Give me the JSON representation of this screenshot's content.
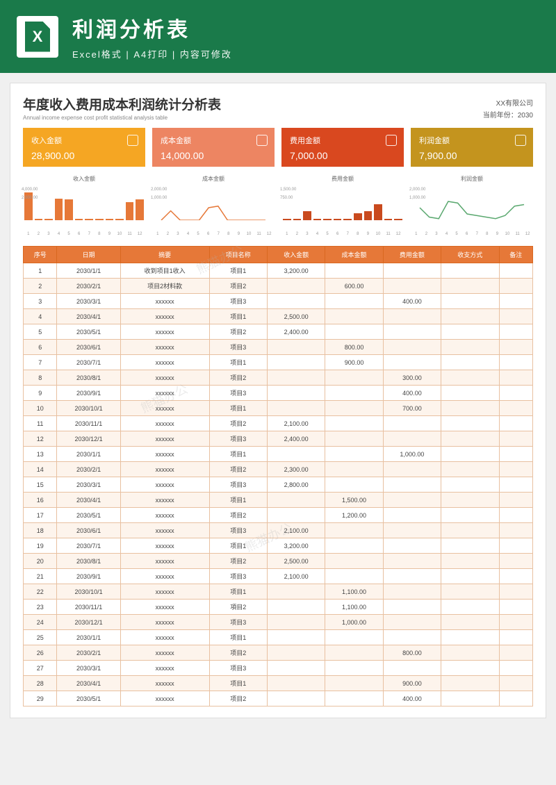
{
  "banner": {
    "title": "利润分析表",
    "sub": "Excel格式 | A4打印 | 内容可修改"
  },
  "sheet": {
    "title": "年度收入费用成本利润统计分析表",
    "sub": "Annual income expense cost profit statistical analysis table",
    "company": "XX有限公司",
    "year": "当前年份：2030"
  },
  "cards": [
    {
      "label": "收入金额",
      "value": "28,900.00"
    },
    {
      "label": "成本金额",
      "value": "14,000.00"
    },
    {
      "label": "费用金额",
      "value": "7,000.00"
    },
    {
      "label": "利润金额",
      "value": "7,900.00"
    }
  ],
  "chart_data": [
    {
      "type": "bar",
      "title": "收入金额",
      "categories": [
        "1",
        "2",
        "3",
        "4",
        "5",
        "6",
        "7",
        "8",
        "9",
        "10",
        "11",
        "12"
      ],
      "values": [
        3200,
        0,
        0,
        2500,
        2400,
        0,
        0,
        0,
        0,
        0,
        2100,
        2400
      ],
      "ylim": [
        0,
        4000
      ],
      "color": "#e67838"
    },
    {
      "type": "line",
      "title": "成本金额",
      "categories": [
        "1",
        "2",
        "3",
        "4",
        "5",
        "6",
        "7",
        "8",
        "9",
        "10",
        "11",
        "12"
      ],
      "values": [
        0,
        600,
        0,
        0,
        0,
        800,
        900,
        0,
        0,
        0,
        0,
        0
      ],
      "ylim": [
        0,
        2000
      ],
      "color": "#e67838"
    },
    {
      "type": "bar",
      "title": "费用金额",
      "categories": [
        "1",
        "2",
        "3",
        "4",
        "5",
        "6",
        "7",
        "8",
        "9",
        "10",
        "11",
        "12"
      ],
      "values": [
        0,
        0,
        400,
        0,
        0,
        0,
        0,
        300,
        400,
        700,
        0,
        0
      ],
      "ylim": [
        0,
        1500
      ],
      "color": "#c94a1e"
    },
    {
      "type": "line",
      "title": "利润金额",
      "categories": [
        "1",
        "2",
        "3",
        "4",
        "5",
        "6",
        "7",
        "8",
        "9",
        "10",
        "11",
        "12"
      ],
      "values": [
        800,
        200,
        100,
        1200,
        1100,
        400,
        300,
        200,
        100,
        300,
        900,
        1000
      ],
      "ylim": [
        0,
        2000
      ],
      "color": "#5aa86f"
    }
  ],
  "table": {
    "headers": [
      "序号",
      "日期",
      "摘要",
      "项目名称",
      "收入金额",
      "成本金额",
      "费用金额",
      "收支方式",
      "备注"
    ],
    "rows": [
      [
        "1",
        "2030/1/1",
        "收到项目1收入",
        "项目1",
        "3,200.00",
        "",
        "",
        "",
        ""
      ],
      [
        "2",
        "2030/2/1",
        "项目2材料款",
        "项目2",
        "",
        "600.00",
        "",
        "",
        ""
      ],
      [
        "3",
        "2030/3/1",
        "xxxxxx",
        "项目3",
        "",
        "",
        "400.00",
        "",
        ""
      ],
      [
        "4",
        "2030/4/1",
        "xxxxxx",
        "项目1",
        "2,500.00",
        "",
        "",
        "",
        ""
      ],
      [
        "5",
        "2030/5/1",
        "xxxxxx",
        "项目2",
        "2,400.00",
        "",
        "",
        "",
        ""
      ],
      [
        "6",
        "2030/6/1",
        "xxxxxx",
        "项目3",
        "",
        "800.00",
        "",
        "",
        ""
      ],
      [
        "7",
        "2030/7/1",
        "xxxxxx",
        "项目1",
        "",
        "900.00",
        "",
        "",
        ""
      ],
      [
        "8",
        "2030/8/1",
        "xxxxxx",
        "项目2",
        "",
        "",
        "300.00",
        "",
        ""
      ],
      [
        "9",
        "2030/9/1",
        "xxxxxx",
        "项目3",
        "",
        "",
        "400.00",
        "",
        ""
      ],
      [
        "10",
        "2030/10/1",
        "xxxxxx",
        "项目1",
        "",
        "",
        "700.00",
        "",
        ""
      ],
      [
        "11",
        "2030/11/1",
        "xxxxxx",
        "项目2",
        "2,100.00",
        "",
        "",
        "",
        ""
      ],
      [
        "12",
        "2030/12/1",
        "xxxxxx",
        "项目3",
        "2,400.00",
        "",
        "",
        "",
        ""
      ],
      [
        "13",
        "2030/1/1",
        "xxxxxx",
        "项目1",
        "",
        "",
        "1,000.00",
        "",
        ""
      ],
      [
        "14",
        "2030/2/1",
        "xxxxxx",
        "项目2",
        "2,300.00",
        "",
        "",
        "",
        ""
      ],
      [
        "15",
        "2030/3/1",
        "xxxxxx",
        "项目3",
        "2,800.00",
        "",
        "",
        "",
        ""
      ],
      [
        "16",
        "2030/4/1",
        "xxxxxx",
        "项目1",
        "",
        "1,500.00",
        "",
        "",
        ""
      ],
      [
        "17",
        "2030/5/1",
        "xxxxxx",
        "项目2",
        "",
        "1,200.00",
        "",
        "",
        ""
      ],
      [
        "18",
        "2030/6/1",
        "xxxxxx",
        "项目3",
        "2,100.00",
        "",
        "",
        "",
        ""
      ],
      [
        "19",
        "2030/7/1",
        "xxxxxx",
        "项目1",
        "3,200.00",
        "",
        "",
        "",
        ""
      ],
      [
        "20",
        "2030/8/1",
        "xxxxxx",
        "项目2",
        "2,500.00",
        "",
        "",
        "",
        ""
      ],
      [
        "21",
        "2030/9/1",
        "xxxxxx",
        "项目3",
        "2,100.00",
        "",
        "",
        "",
        ""
      ],
      [
        "22",
        "2030/10/1",
        "xxxxxx",
        "项目1",
        "",
        "1,100.00",
        "",
        "",
        ""
      ],
      [
        "23",
        "2030/11/1",
        "xxxxxx",
        "項目2",
        "",
        "1,100.00",
        "",
        "",
        ""
      ],
      [
        "24",
        "2030/12/1",
        "xxxxxx",
        "项目3",
        "",
        "1,000.00",
        "",
        "",
        ""
      ],
      [
        "25",
        "2030/1/1",
        "xxxxxx",
        "项目1",
        "",
        "",
        "",
        "",
        ""
      ],
      [
        "26",
        "2030/2/1",
        "xxxxxx",
        "项目2",
        "",
        "",
        "800.00",
        "",
        ""
      ],
      [
        "27",
        "2030/3/1",
        "xxxxxx",
        "项目3",
        "",
        "",
        "",
        "",
        ""
      ],
      [
        "28",
        "2030/4/1",
        "xxxxxx",
        "项目1",
        "",
        "",
        "900.00",
        "",
        ""
      ],
      [
        "29",
        "2030/5/1",
        "xxxxxx",
        "项目2",
        "",
        "",
        "400.00",
        "",
        ""
      ]
    ]
  },
  "watermark": "熊猫办公"
}
